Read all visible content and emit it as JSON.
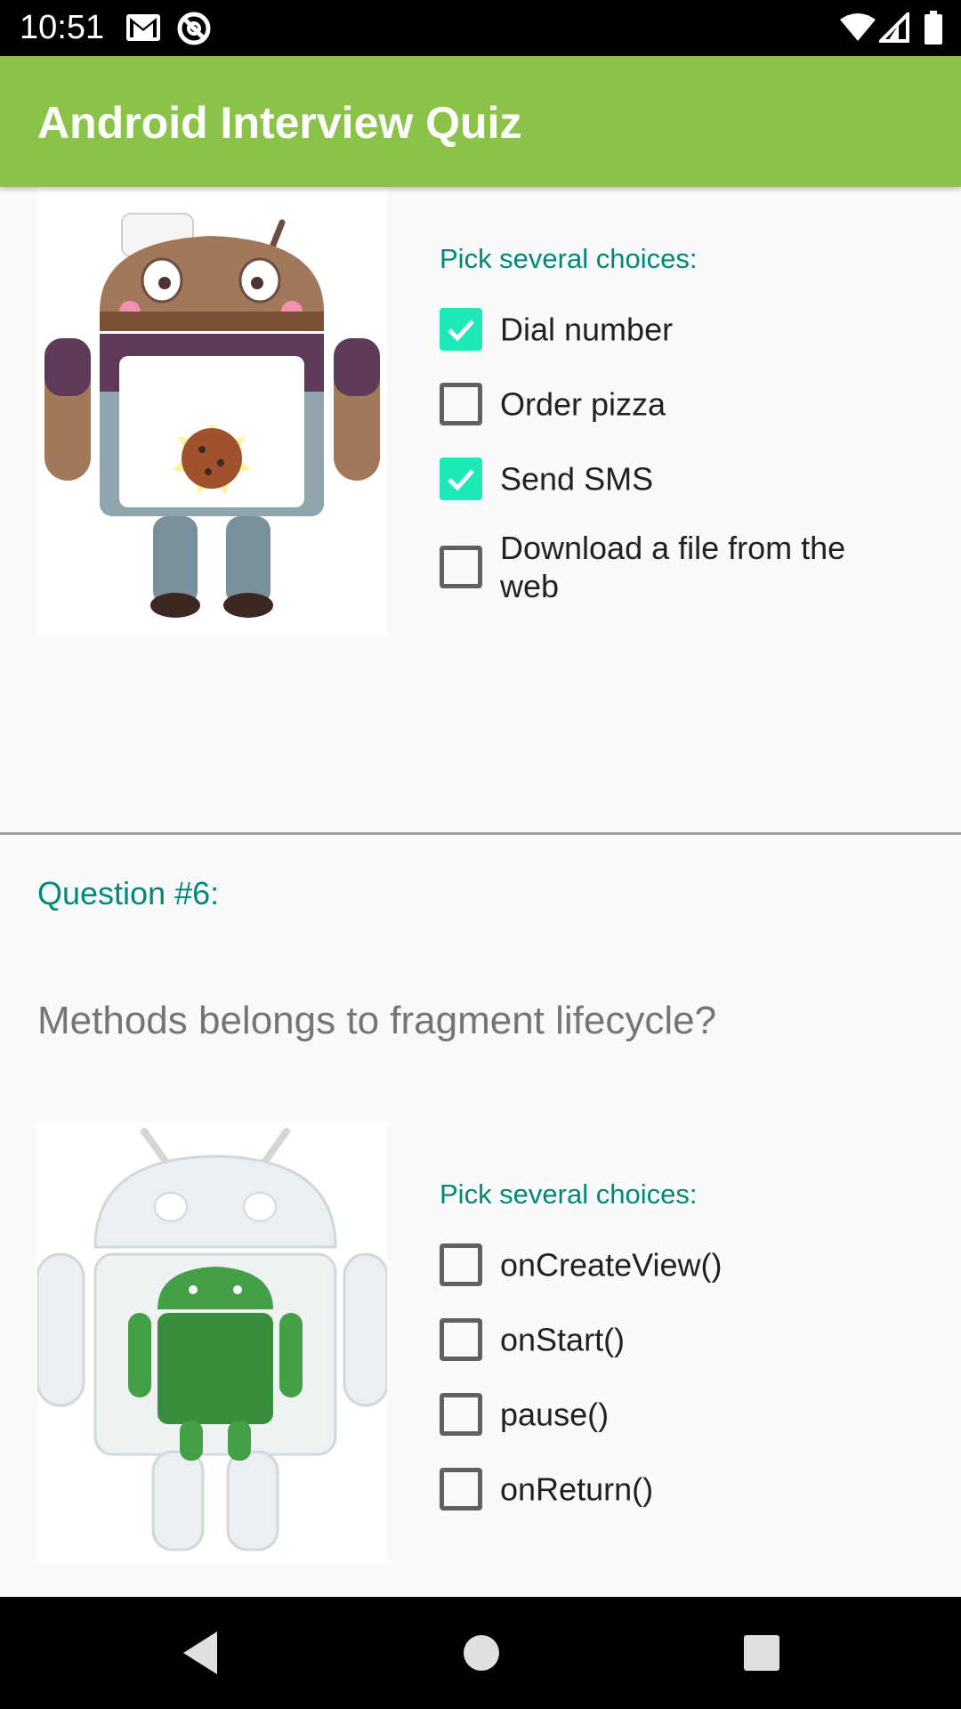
{
  "status_bar": {
    "time": "10:51",
    "icons": [
      "gmail-icon",
      "sync-icon",
      "wifi-icon",
      "signal-icon",
      "battery-icon"
    ]
  },
  "app_bar": {
    "title": "Android Interview Quiz",
    "color": "#8bc34a"
  },
  "question5": {
    "image": "android-cookie-chef-figure",
    "pick_label": "Pick several choices:",
    "options": [
      {
        "label": "Dial number",
        "checked": true
      },
      {
        "label": "Order pizza",
        "checked": false
      },
      {
        "label": "Send SMS",
        "checked": true
      },
      {
        "label": "Download a file from the web",
        "checked": false
      }
    ]
  },
  "question6": {
    "number": "Question #6:",
    "text": "Methods belongs to fragment lifecycle?",
    "image": "android-clear-figure",
    "pick_label": "Pick several choices:",
    "options": [
      {
        "label": "onCreateView()",
        "checked": false
      },
      {
        "label": "onStart()",
        "checked": false
      },
      {
        "label": "pause()",
        "checked": false
      },
      {
        "label": "onReturn()",
        "checked": false
      }
    ]
  },
  "nav_bar": {
    "buttons": [
      "back-icon",
      "home-icon",
      "recents-icon"
    ]
  },
  "colors": {
    "accent": "#1de9b6",
    "teal_text": "#00897b",
    "app_bar": "#8bc34a"
  }
}
